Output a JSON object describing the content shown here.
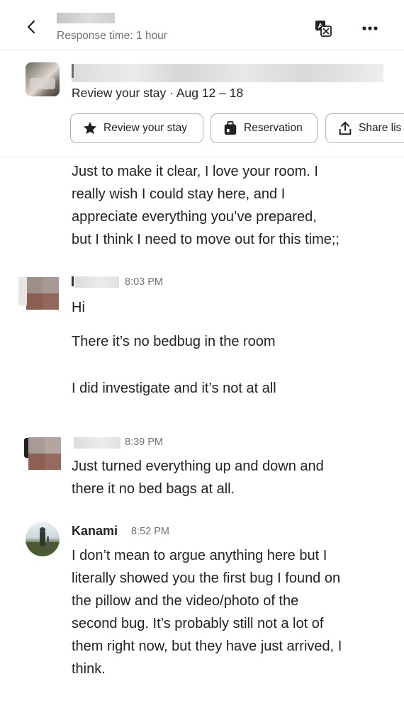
{
  "header": {
    "response_time": "Response time: 1 hour",
    "translate_icon": "translate-icon",
    "more_icon": "more-horizontal-icon",
    "back_icon": "chevron-left-icon"
  },
  "banner": {
    "review_line": "Review your stay · Aug 12 – 18",
    "chips": [
      {
        "label": "Review your stay",
        "icon": "star-icon"
      },
      {
        "label": "Reservation",
        "icon": "luggage-icon"
      },
      {
        "label": "Share lis",
        "icon": "share-icon"
      }
    ]
  },
  "messages": [
    {
      "lines": [
        "Just to make it clear, I love your room. I",
        "really wish I could stay here, and I",
        "appreciate everything you’ve prepared,",
        "but I think I need to move out for this time;;"
      ]
    },
    {
      "time": "8:03 PM",
      "paragraphs": [
        "Hi",
        "There it’s no bedbug in the room",
        "I did investigate and it’s not at all"
      ]
    },
    {
      "time": "8:39 PM",
      "lines": [
        "Just turned everything up and down and",
        "there it no bed bags at all."
      ]
    },
    {
      "sender": "Kanami",
      "time": "8:52 PM",
      "lines": [
        "I don’t mean to argue anything here but I",
        "literally showed you the first bug I found on",
        "the pillow and the video/photo of the",
        "second bug. It’s probably still not a lot of",
        "them right now, but they have just arrived, I",
        "think."
      ]
    }
  ],
  "colors": {
    "text": "#222222",
    "secondary_text": "#717171",
    "border": "#b0b0b0",
    "divider": "#e6e6e6"
  }
}
